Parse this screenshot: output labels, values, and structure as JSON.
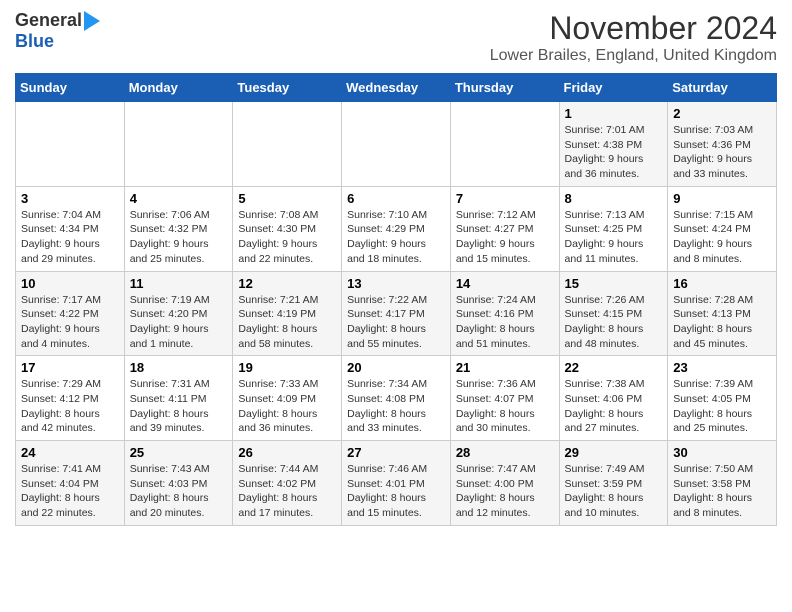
{
  "header": {
    "logo_general": "General",
    "logo_blue": "Blue",
    "month_title": "November 2024",
    "location": "Lower Brailes, England, United Kingdom"
  },
  "days_of_week": [
    "Sunday",
    "Monday",
    "Tuesday",
    "Wednesday",
    "Thursday",
    "Friday",
    "Saturday"
  ],
  "weeks": [
    [
      {
        "day": "",
        "info": ""
      },
      {
        "day": "",
        "info": ""
      },
      {
        "day": "",
        "info": ""
      },
      {
        "day": "",
        "info": ""
      },
      {
        "day": "",
        "info": ""
      },
      {
        "day": "1",
        "info": "Sunrise: 7:01 AM\nSunset: 4:38 PM\nDaylight: 9 hours and 36 minutes."
      },
      {
        "day": "2",
        "info": "Sunrise: 7:03 AM\nSunset: 4:36 PM\nDaylight: 9 hours and 33 minutes."
      }
    ],
    [
      {
        "day": "3",
        "info": "Sunrise: 7:04 AM\nSunset: 4:34 PM\nDaylight: 9 hours and 29 minutes."
      },
      {
        "day": "4",
        "info": "Sunrise: 7:06 AM\nSunset: 4:32 PM\nDaylight: 9 hours and 25 minutes."
      },
      {
        "day": "5",
        "info": "Sunrise: 7:08 AM\nSunset: 4:30 PM\nDaylight: 9 hours and 22 minutes."
      },
      {
        "day": "6",
        "info": "Sunrise: 7:10 AM\nSunset: 4:29 PM\nDaylight: 9 hours and 18 minutes."
      },
      {
        "day": "7",
        "info": "Sunrise: 7:12 AM\nSunset: 4:27 PM\nDaylight: 9 hours and 15 minutes."
      },
      {
        "day": "8",
        "info": "Sunrise: 7:13 AM\nSunset: 4:25 PM\nDaylight: 9 hours and 11 minutes."
      },
      {
        "day": "9",
        "info": "Sunrise: 7:15 AM\nSunset: 4:24 PM\nDaylight: 9 hours and 8 minutes."
      }
    ],
    [
      {
        "day": "10",
        "info": "Sunrise: 7:17 AM\nSunset: 4:22 PM\nDaylight: 9 hours and 4 minutes."
      },
      {
        "day": "11",
        "info": "Sunrise: 7:19 AM\nSunset: 4:20 PM\nDaylight: 9 hours and 1 minute."
      },
      {
        "day": "12",
        "info": "Sunrise: 7:21 AM\nSunset: 4:19 PM\nDaylight: 8 hours and 58 minutes."
      },
      {
        "day": "13",
        "info": "Sunrise: 7:22 AM\nSunset: 4:17 PM\nDaylight: 8 hours and 55 minutes."
      },
      {
        "day": "14",
        "info": "Sunrise: 7:24 AM\nSunset: 4:16 PM\nDaylight: 8 hours and 51 minutes."
      },
      {
        "day": "15",
        "info": "Sunrise: 7:26 AM\nSunset: 4:15 PM\nDaylight: 8 hours and 48 minutes."
      },
      {
        "day": "16",
        "info": "Sunrise: 7:28 AM\nSunset: 4:13 PM\nDaylight: 8 hours and 45 minutes."
      }
    ],
    [
      {
        "day": "17",
        "info": "Sunrise: 7:29 AM\nSunset: 4:12 PM\nDaylight: 8 hours and 42 minutes."
      },
      {
        "day": "18",
        "info": "Sunrise: 7:31 AM\nSunset: 4:11 PM\nDaylight: 8 hours and 39 minutes."
      },
      {
        "day": "19",
        "info": "Sunrise: 7:33 AM\nSunset: 4:09 PM\nDaylight: 8 hours and 36 minutes."
      },
      {
        "day": "20",
        "info": "Sunrise: 7:34 AM\nSunset: 4:08 PM\nDaylight: 8 hours and 33 minutes."
      },
      {
        "day": "21",
        "info": "Sunrise: 7:36 AM\nSunset: 4:07 PM\nDaylight: 8 hours and 30 minutes."
      },
      {
        "day": "22",
        "info": "Sunrise: 7:38 AM\nSunset: 4:06 PM\nDaylight: 8 hours and 27 minutes."
      },
      {
        "day": "23",
        "info": "Sunrise: 7:39 AM\nSunset: 4:05 PM\nDaylight: 8 hours and 25 minutes."
      }
    ],
    [
      {
        "day": "24",
        "info": "Sunrise: 7:41 AM\nSunset: 4:04 PM\nDaylight: 8 hours and 22 minutes."
      },
      {
        "day": "25",
        "info": "Sunrise: 7:43 AM\nSunset: 4:03 PM\nDaylight: 8 hours and 20 minutes."
      },
      {
        "day": "26",
        "info": "Sunrise: 7:44 AM\nSunset: 4:02 PM\nDaylight: 8 hours and 17 minutes."
      },
      {
        "day": "27",
        "info": "Sunrise: 7:46 AM\nSunset: 4:01 PM\nDaylight: 8 hours and 15 minutes."
      },
      {
        "day": "28",
        "info": "Sunrise: 7:47 AM\nSunset: 4:00 PM\nDaylight: 8 hours and 12 minutes."
      },
      {
        "day": "29",
        "info": "Sunrise: 7:49 AM\nSunset: 3:59 PM\nDaylight: 8 hours and 10 minutes."
      },
      {
        "day": "30",
        "info": "Sunrise: 7:50 AM\nSunset: 3:58 PM\nDaylight: 8 hours and 8 minutes."
      }
    ]
  ]
}
